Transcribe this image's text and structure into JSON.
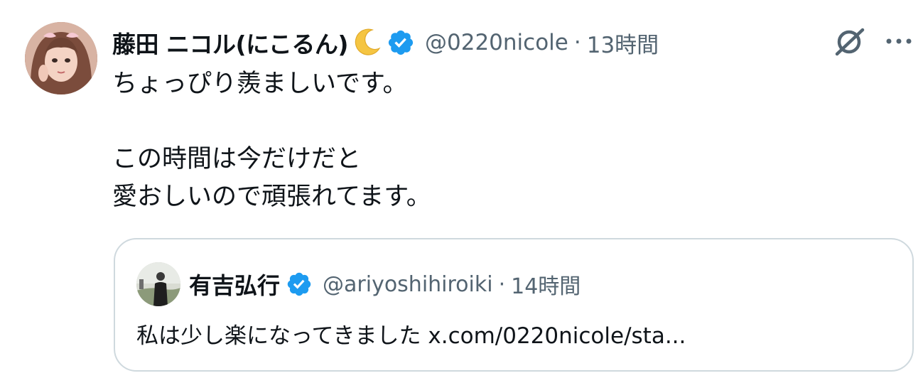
{
  "tweet": {
    "author": {
      "display_name": "藤田 ニコル(にこるん)",
      "handle": "@0220nicole",
      "verified": true
    },
    "separator": "·",
    "time": "13時間",
    "text": "ちょっぴり羨ましいです。\n\nこの時間は今だけだと\n愛おしいので頑張れてます。",
    "actions": {
      "grok_icon": "grok-icon",
      "more_icon": "more-icon"
    }
  },
  "quote": {
    "author": {
      "display_name": "有吉弘行",
      "handle": "@ariyoshihiroiki",
      "verified": true
    },
    "separator": "·",
    "time": "14時間",
    "text": "私は少し楽になってきました x.com/0220nicole/sta..."
  },
  "colors": {
    "text_primary": "#0f1419",
    "text_secondary": "#536471",
    "verified_blue": "#1d9bf0",
    "border": "#cfd9de",
    "moon": "#f5c542"
  }
}
